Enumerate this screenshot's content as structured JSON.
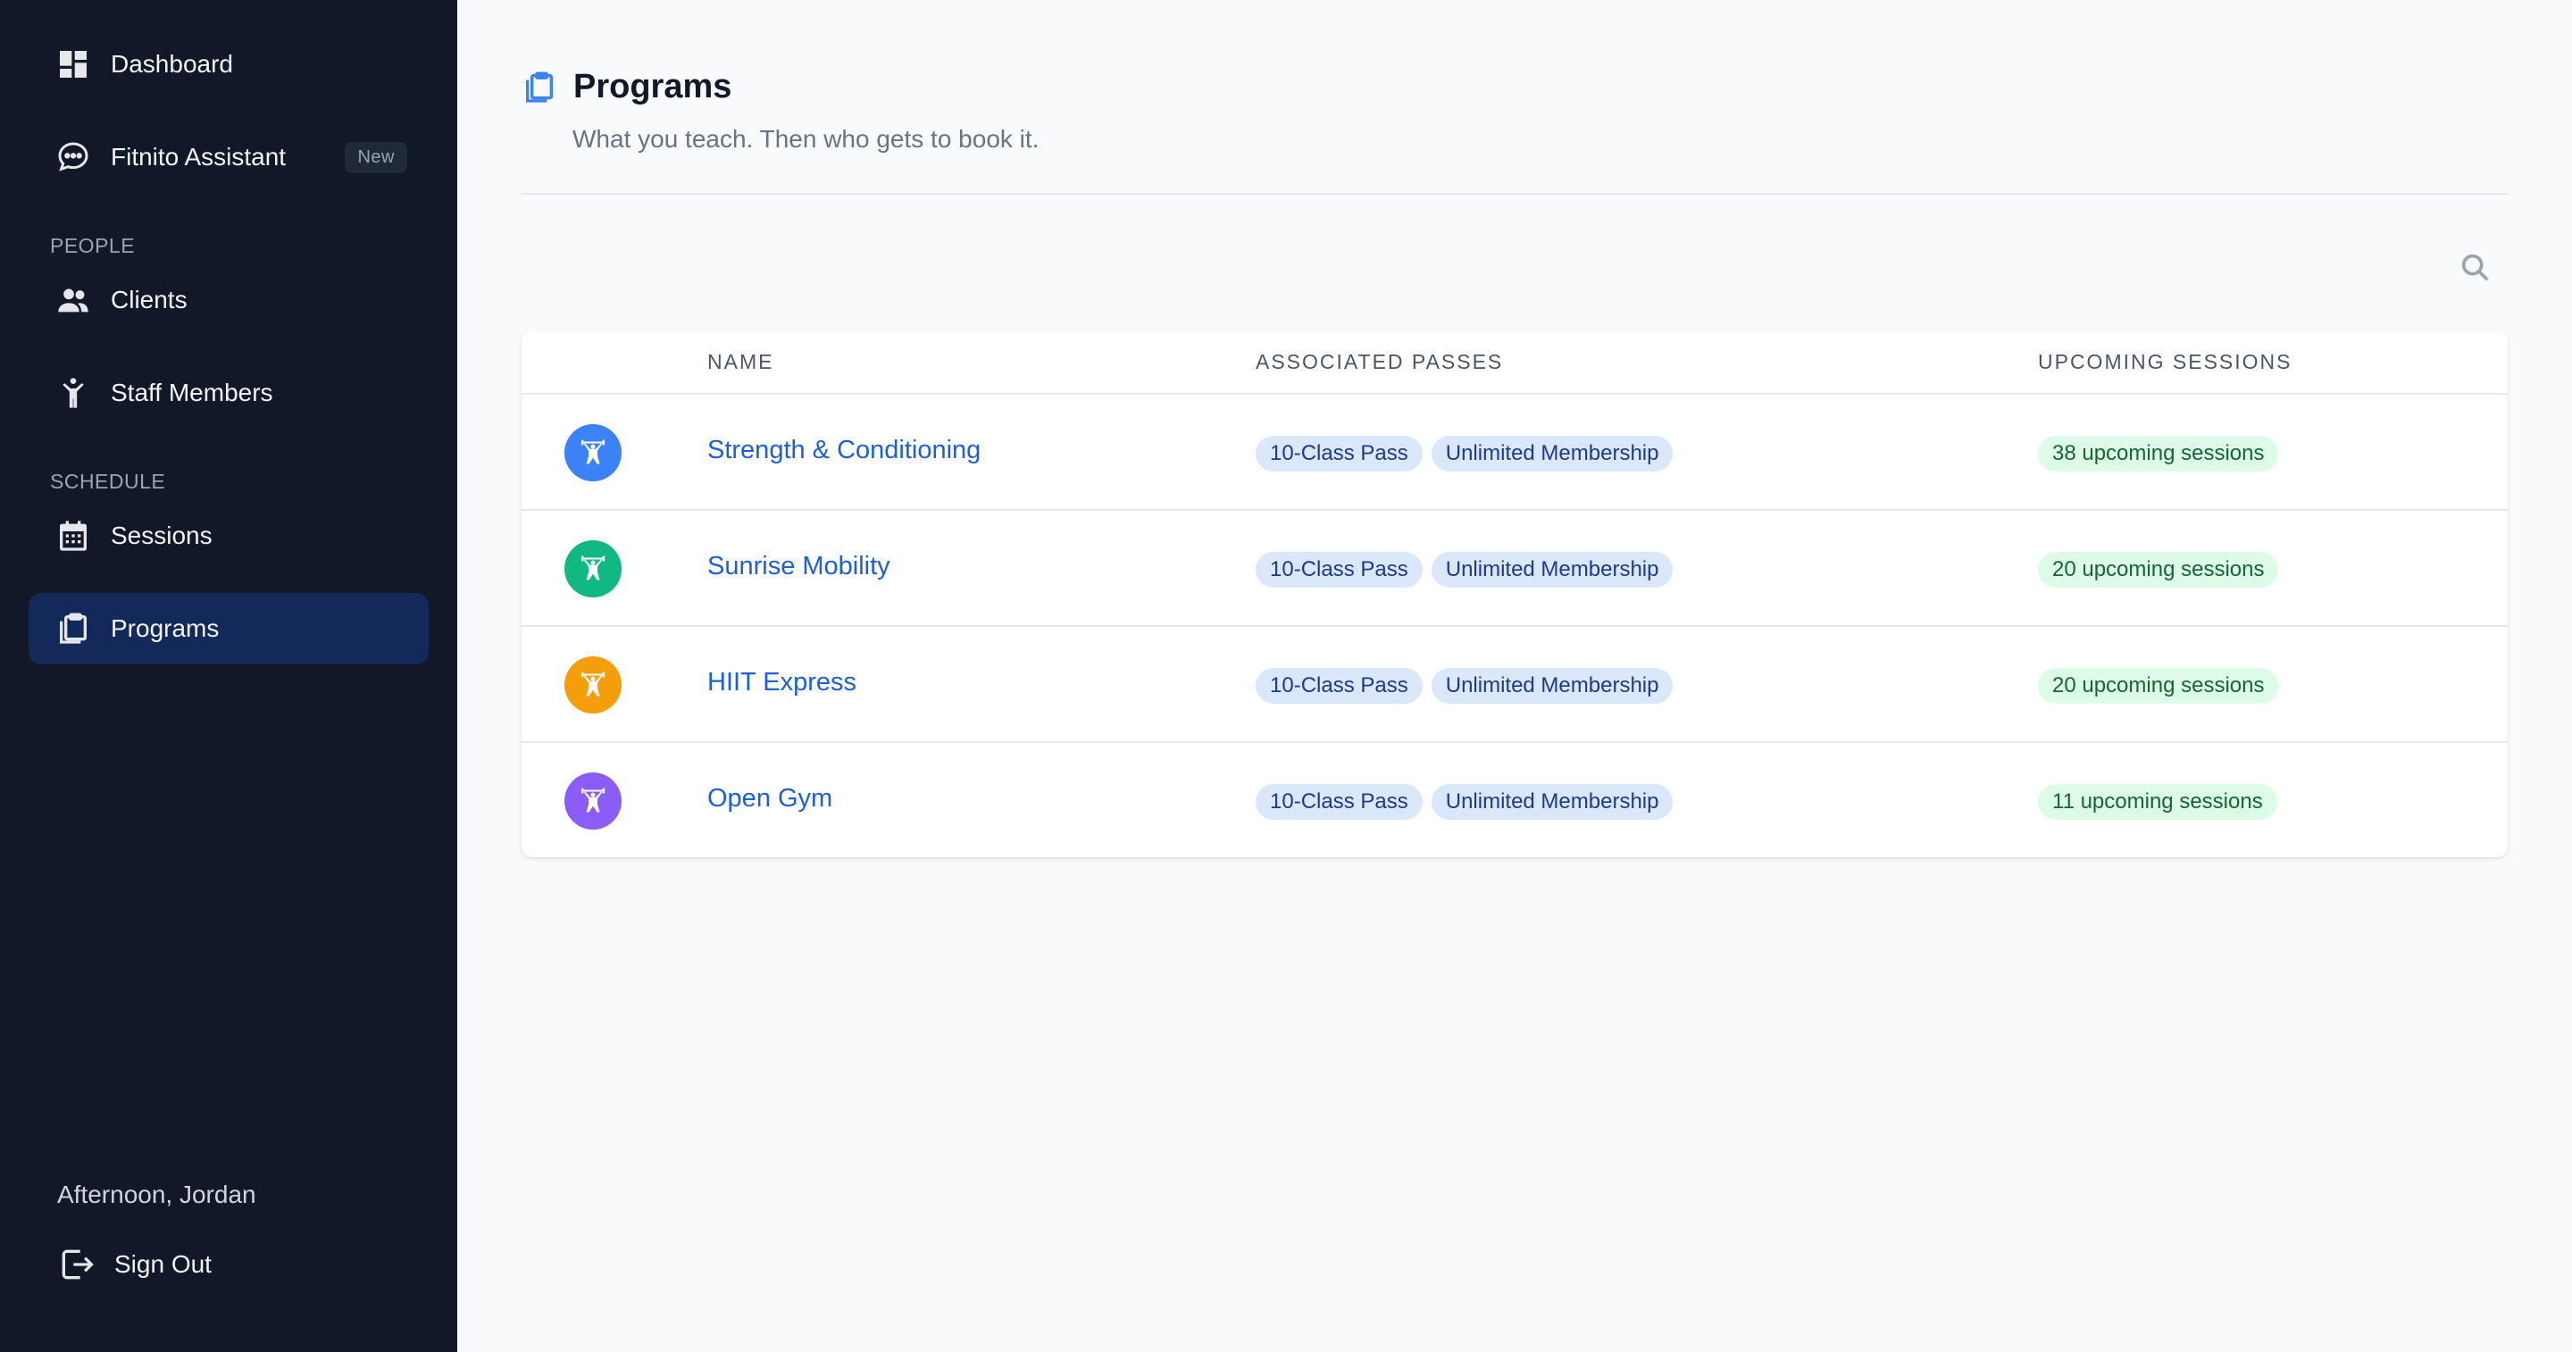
{
  "sidebar": {
    "items": [
      {
        "label": "Dashboard",
        "icon": "dashboard-icon"
      },
      {
        "label": "Fitnito Assistant",
        "icon": "chat-bubble-icon",
        "badge": "New"
      },
      {
        "label": "Clients",
        "icon": "people-icon"
      },
      {
        "label": "Staff Members",
        "icon": "person-standing-icon"
      },
      {
        "label": "Sessions",
        "icon": "calendar-icon"
      },
      {
        "label": "Programs",
        "icon": "clipboard-icon",
        "active": true
      }
    ],
    "sections": {
      "people": "PEOPLE",
      "schedule": "SCHEDULE"
    },
    "greeting": "Afternoon, Jordan",
    "sign_out": "Sign Out"
  },
  "header": {
    "title": "Programs",
    "subtitle": "What you teach. Then who gets to book it."
  },
  "table": {
    "columns": [
      "NAME",
      "ASSOCIATED PASSES",
      "UPCOMING SESSIONS"
    ],
    "rows": [
      {
        "name": "Strength & Conditioning",
        "color": "#3b82f6",
        "passes": [
          "10-Class Pass",
          "Unlimited Membership"
        ],
        "sessions": "38 upcoming sessions"
      },
      {
        "name": "Sunrise Mobility",
        "color": "#10b981",
        "passes": [
          "10-Class Pass",
          "Unlimited Membership"
        ],
        "sessions": "20 upcoming sessions"
      },
      {
        "name": "HIIT Express",
        "color": "#f59e0b",
        "passes": [
          "10-Class Pass",
          "Unlimited Membership"
        ],
        "sessions": "20 upcoming sessions"
      },
      {
        "name": "Open Gym",
        "color": "#8b5cf6",
        "passes": [
          "10-Class Pass",
          "Unlimited Membership"
        ],
        "sessions": "11 upcoming sessions"
      }
    ]
  },
  "colors": {
    "sidebar_bg": "#111827",
    "active_bg": "#13295a",
    "link": "#1d5fd6",
    "pass_pill_bg": "#dbe7fb",
    "session_pill_bg": "#dcfce7"
  }
}
